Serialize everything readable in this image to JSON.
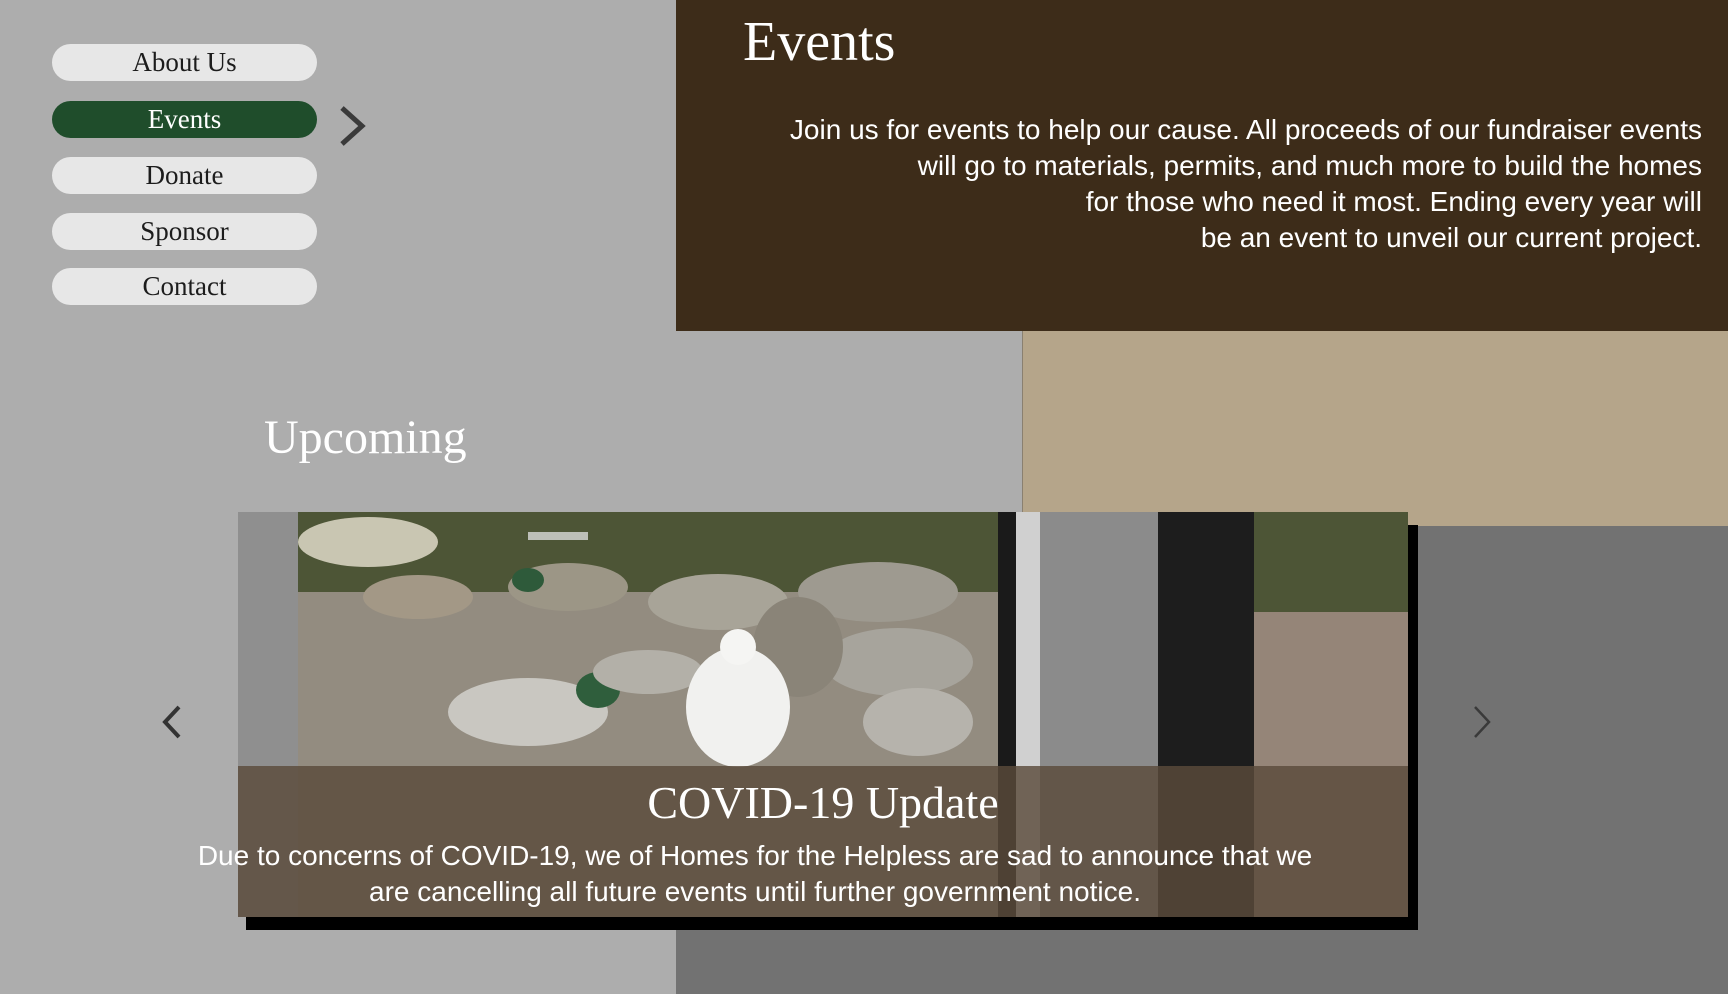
{
  "nav": {
    "items": [
      {
        "label": "About Us",
        "active": false
      },
      {
        "label": "Events",
        "active": true
      },
      {
        "label": "Donate",
        "active": false
      },
      {
        "label": "Sponsor",
        "active": false
      },
      {
        "label": "Contact",
        "active": false
      }
    ],
    "current_indicator_icon": "chevron-right-icon"
  },
  "header": {
    "title": "Events",
    "description_lines": [
      "Join us for events to help our cause. All proceeds of our fundraiser events",
      "will go to materials, permits, and much more to build the homes",
      "for those who need it most. Ending every year will",
      "be an event to unveil our current project."
    ]
  },
  "upcoming": {
    "title": "Upcoming",
    "slide": {
      "image_subject": "ducks feeding by a pond",
      "caption_title": "COVID-19 Update",
      "caption_lines": [
        "Due to concerns of COVID-19, we of Homes for the Helpless are sad to announce that we",
        "are cancelling all future events until further government notice."
      ]
    },
    "prev_icon": "chevron-left-icon",
    "next_icon": "chevron-right-icon"
  },
  "colors": {
    "page_bg": "#adadad",
    "header_bg": "#3d2c19",
    "tan_accent": "#b5a58a",
    "dark_gray": "#727272",
    "nav_active": "#1f4d2b",
    "nav_inactive": "#e7e7e7"
  }
}
